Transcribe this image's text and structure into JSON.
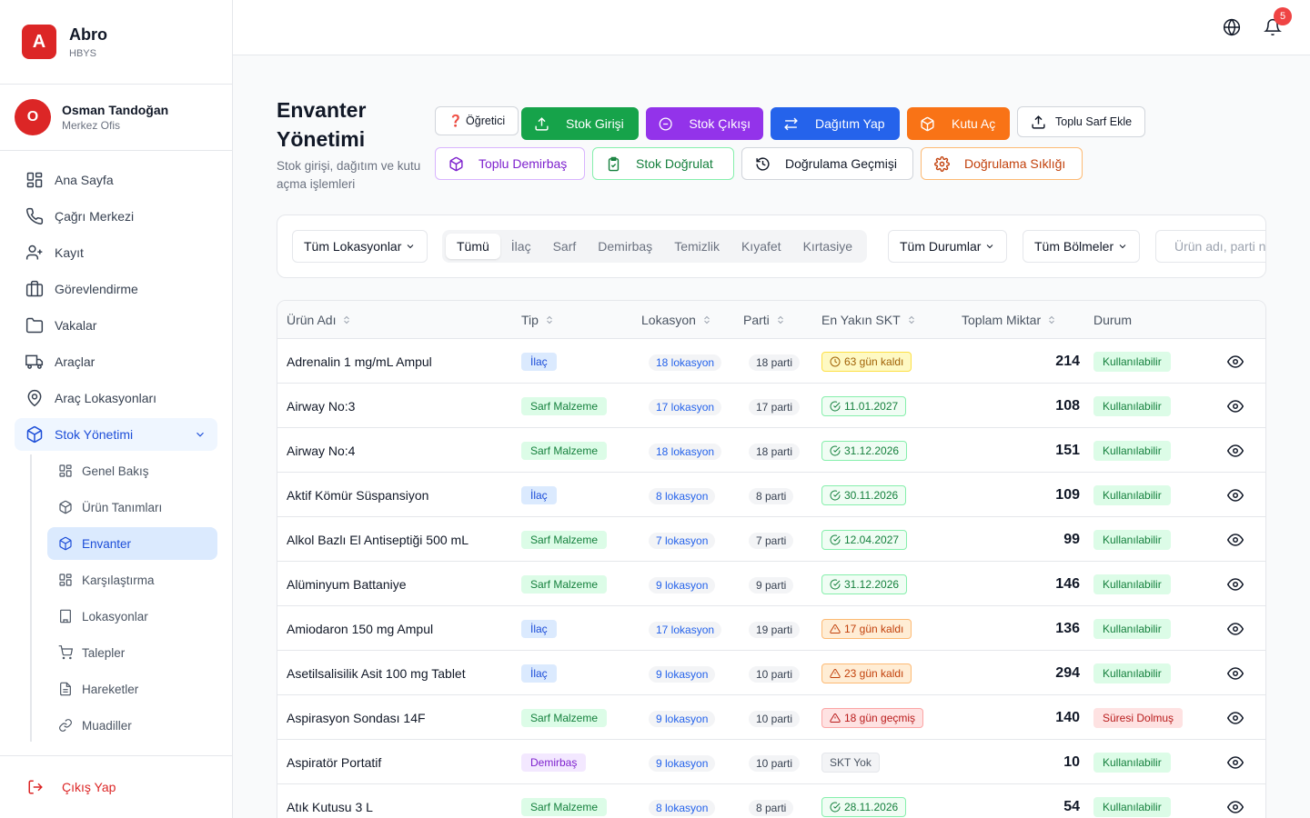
{
  "brand": {
    "logo_letter": "A",
    "name": "Abro",
    "subtitle": "HBYS"
  },
  "user": {
    "initial": "O",
    "name": "Osman Tandoğan",
    "role": "Merkez Ofis"
  },
  "nav": {
    "items": [
      {
        "label": "Ana Sayfa",
        "icon": "grid-icon"
      },
      {
        "label": "Çağrı Merkezi",
        "icon": "phone-icon"
      },
      {
        "label": "Kayıt",
        "icon": "user-plus-icon"
      },
      {
        "label": "Görevlendirme",
        "icon": "briefcase-icon"
      },
      {
        "label": "Vakalar",
        "icon": "folder-icon"
      },
      {
        "label": "Araçlar",
        "icon": "truck-icon"
      },
      {
        "label": "Araç Lokasyonları",
        "icon": "map-pin-icon"
      },
      {
        "label": "Stok Yönetimi",
        "icon": "package-icon"
      }
    ],
    "sub_items": [
      {
        "label": "Genel Bakış",
        "icon": "grid-icon"
      },
      {
        "label": "Ürün Tanımları",
        "icon": "package-icon"
      },
      {
        "label": "Envanter",
        "icon": "package-icon"
      },
      {
        "label": "Karşılaştırma",
        "icon": "grid-icon"
      },
      {
        "label": "Lokasyonlar",
        "icon": "building-icon"
      },
      {
        "label": "Talepler",
        "icon": "cart-icon"
      },
      {
        "label": "Hareketler",
        "icon": "file-icon"
      },
      {
        "label": "Muadiller",
        "icon": "link-icon"
      }
    ],
    "logout": "Çıkış Yap"
  },
  "topbar": {
    "notification_count": "5"
  },
  "page": {
    "title": "Envanter Yönetimi",
    "subtitle": "Stok girişi, dağıtım ve kutu açma işlemleri"
  },
  "actions": {
    "ogretici": "❓ Öğretici",
    "stok_girisi": "Stok Girişi",
    "stok_cikisi": "Stok Çıkışı",
    "dagitim_yap": "Dağıtım Yap",
    "kutu_ac": "Kutu Aç",
    "toplu_sarf_ekle": "Toplu Sarf Ekle",
    "toplu_demirbas": "Toplu Demirbaş",
    "stok_dogrula": "Stok Doğrulat",
    "dogrulama_gecmisi": "Doğrulama Geçmişi",
    "dogrulama_sikligi": "Doğrulama Sıklığı"
  },
  "filters": {
    "location": "Tüm Lokasyonlar",
    "tabs": [
      "Tümü",
      "İlaç",
      "Sarf",
      "Demirbaş",
      "Temizlik",
      "Kıyafet",
      "Kırtasiye"
    ],
    "status": "Tüm Durumlar",
    "department": "Tüm Bölmeler",
    "search_placeholder": "Ürün adı, parti no, seri no ara..."
  },
  "table": {
    "headers": [
      "Ürün Adı",
      "Tip",
      "Lokasyon",
      "Parti",
      "En Yakın SKT",
      "Toplam Miktar",
      "Durum"
    ],
    "rows": [
      {
        "name": "Adrenalin 1 mg/mL Ampul",
        "type": "İlaç",
        "locations": "18 lokasyon",
        "lots": "18 parti",
        "skt": "63 gün kaldı",
        "qty": "214",
        "status": "Kullanılabilir"
      },
      {
        "name": "Airway No:3",
        "type": "Sarf Malzeme",
        "locations": "17 lokasyon",
        "lots": "17 parti",
        "skt": "11.01.2027",
        "qty": "108",
        "status": "Kullanılabilir"
      },
      {
        "name": "Airway No:4",
        "type": "Sarf Malzeme",
        "locations": "18 lokasyon",
        "lots": "18 parti",
        "skt": "31.12.2026",
        "qty": "151",
        "status": "Kullanılabilir"
      },
      {
        "name": "Aktif Kömür Süspansiyon",
        "type": "İlaç",
        "locations": "8 lokasyon",
        "lots": "8 parti",
        "skt": "30.11.2026",
        "qty": "109",
        "status": "Kullanılabilir"
      },
      {
        "name": "Alkol Bazlı El Antiseptiği 500 mL",
        "type": "Sarf Malzeme",
        "locations": "7 lokasyon",
        "lots": "7 parti",
        "skt": "12.04.2027",
        "qty": "99",
        "status": "Kullanılabilir"
      },
      {
        "name": "Alüminyum Battaniye",
        "type": "Sarf Malzeme",
        "locations": "9 lokasyon",
        "lots": "9 parti",
        "skt": "31.12.2026",
        "qty": "146",
        "status": "Kullanılabilir"
      },
      {
        "name": "Amiodaron 150 mg Ampul",
        "type": "İlaç",
        "locations": "17 lokasyon",
        "lots": "19 parti",
        "skt": "17 gün kaldı",
        "qty": "136",
        "status": "Kullanılabilir"
      },
      {
        "name": "Asetilsalisilik Asit 100 mg Tablet",
        "type": "İlaç",
        "locations": "9 lokasyon",
        "lots": "10 parti",
        "skt": "23 gün kaldı",
        "qty": "294",
        "status": "Kullanılabilir"
      },
      {
        "name": "Aspirasyon Sondası 14F",
        "type": "Sarf Malzeme",
        "locations": "9 lokasyon",
        "lots": "10 parti",
        "skt": "18 gün geçmiş",
        "qty": "140",
        "status": "Süresi Dolmuş"
      },
      {
        "name": "Aspiratör Portatif",
        "type": "Demirbaş",
        "locations": "9 lokasyon",
        "lots": "10 parti",
        "skt": "SKT Yok",
        "qty": "10",
        "status": "Kullanılabilir"
      },
      {
        "name": "Atık Kutusu 3 L",
        "type": "Sarf Malzeme",
        "locations": "8 lokasyon",
        "lots": "8 parti",
        "skt": "28.11.2026",
        "qty": "54",
        "status": "Kullanılabilir"
      }
    ]
  },
  "colors": {
    "brand": "#dc2626",
    "accent": "#2563eb",
    "ok": "#15803d",
    "warn": "#a16207",
    "danger": "#b91c1c"
  }
}
